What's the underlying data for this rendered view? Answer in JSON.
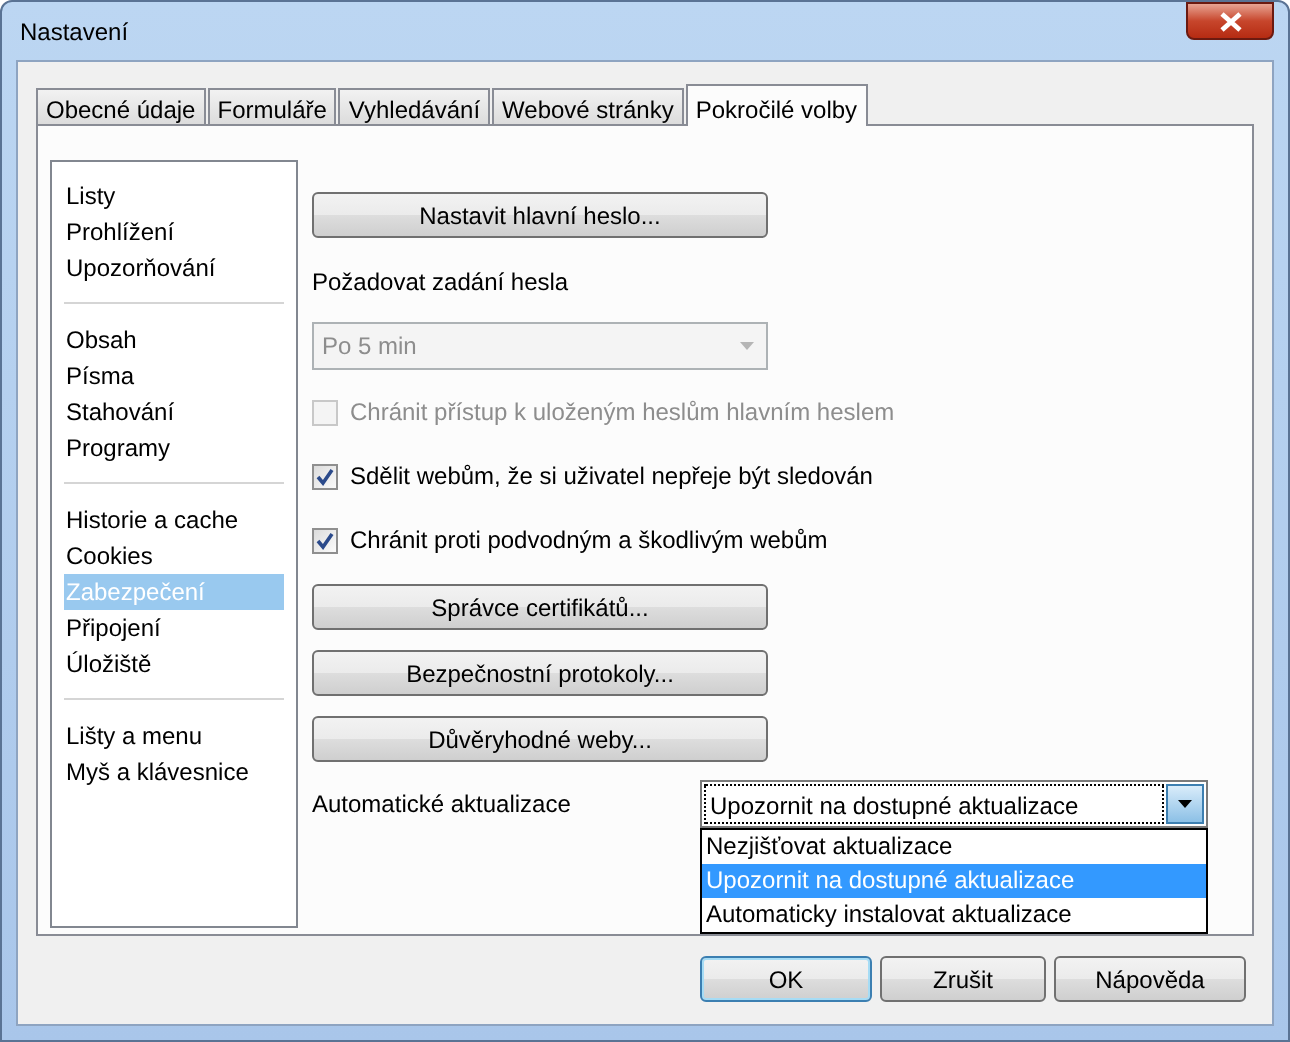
{
  "window": {
    "title": "Nastavení"
  },
  "tabs": [
    {
      "label": "Obecné údaje",
      "selected": false
    },
    {
      "label": "Formuláře",
      "selected": false
    },
    {
      "label": "Vyhledávání",
      "selected": false
    },
    {
      "label": "Webové stránky",
      "selected": false
    },
    {
      "label": "Pokročilé volby",
      "selected": true
    }
  ],
  "sidebar": {
    "groups": [
      {
        "items": [
          {
            "label": "Listy",
            "selected": false
          },
          {
            "label": "Prohlížení",
            "selected": false
          },
          {
            "label": "Upozorňování",
            "selected": false
          }
        ]
      },
      {
        "items": [
          {
            "label": "Obsah",
            "selected": false
          },
          {
            "label": "Písma",
            "selected": false
          },
          {
            "label": "Stahování",
            "selected": false
          },
          {
            "label": "Programy",
            "selected": false
          }
        ]
      },
      {
        "items": [
          {
            "label": "Historie a cache",
            "selected": false
          },
          {
            "label": "Cookies",
            "selected": false
          },
          {
            "label": "Zabezpečení",
            "selected": true
          },
          {
            "label": "Připojení",
            "selected": false
          },
          {
            "label": "Úložiště",
            "selected": false
          }
        ]
      },
      {
        "items": [
          {
            "label": "Lišty a menu",
            "selected": false
          },
          {
            "label": "Myš a klávesnice",
            "selected": false
          }
        ]
      }
    ]
  },
  "master_password_button": "Nastavit hlavní heslo...",
  "require_password": {
    "label": "Požadovat zadání hesla",
    "value": "Po 5 min",
    "disabled": true
  },
  "checkboxes": [
    {
      "label": "Chránit přístup k uloženým heslům hlavním heslem",
      "checked": false,
      "disabled": true
    },
    {
      "label": "Sdělit webům, že si uživatel nepřeje být sledován",
      "checked": true,
      "disabled": false
    },
    {
      "label": "Chránit proti podvodným a škodlivým webům",
      "checked": true,
      "disabled": false
    }
  ],
  "buttons": [
    "Správce certifikátů...",
    "Bezpečnostní protokoly...",
    "Důvěryhodné weby..."
  ],
  "auto_updates": {
    "label": "Automatické aktualizace",
    "value": "Upozornit na dostupné aktualizace",
    "open": true,
    "options": [
      {
        "label": "Nezjišťovat aktualizace",
        "selected": false
      },
      {
        "label": "Upozornit na dostupné aktualizace",
        "selected": true
      },
      {
        "label": "Automaticky instalovat aktualizace",
        "selected": false
      }
    ]
  },
  "footer_buttons": [
    {
      "label": "OK",
      "default": true
    },
    {
      "label": "Zrušit",
      "default": false
    },
    {
      "label": "Nápověda",
      "default": false
    }
  ]
}
